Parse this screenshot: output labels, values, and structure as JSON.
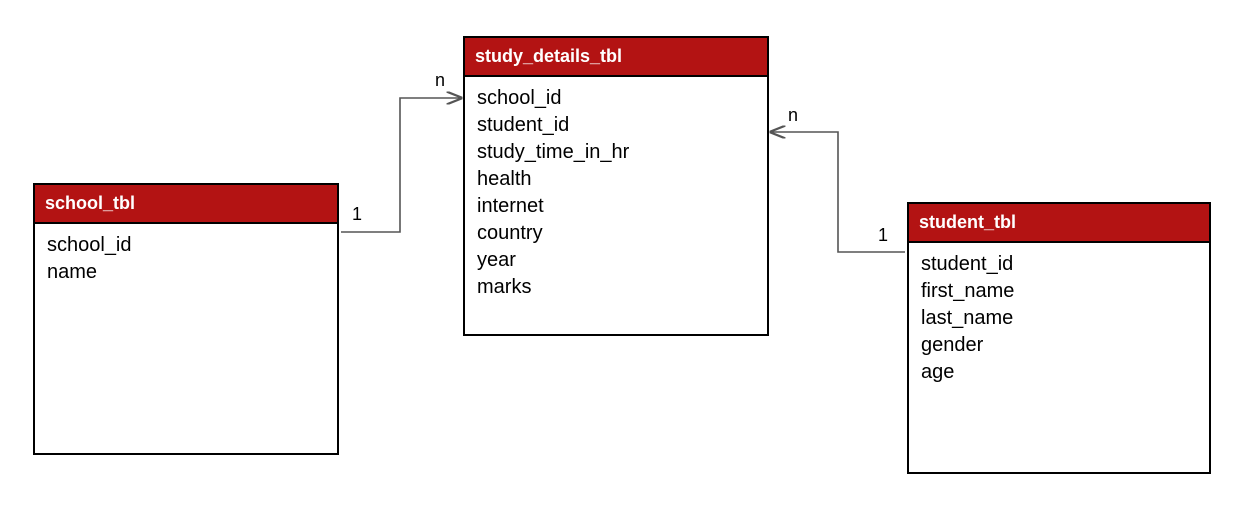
{
  "tables": {
    "school": {
      "title": "school_tbl",
      "fields": [
        "school_id",
        "name"
      ]
    },
    "study_details": {
      "title": "study_details_tbl",
      "fields": [
        "school_id",
        "student_id",
        "study_time_in_hr",
        "health",
        "internet",
        "country",
        "year",
        "marks"
      ]
    },
    "student": {
      "title": "student_tbl",
      "fields": [
        "student_id",
        "first_name",
        "last_name",
        "gender",
        "age"
      ]
    }
  },
  "relationships": {
    "school_to_study": {
      "src_label": "1",
      "dst_label": "n"
    },
    "student_to_study": {
      "src_label": "1",
      "dst_label": "n"
    }
  }
}
